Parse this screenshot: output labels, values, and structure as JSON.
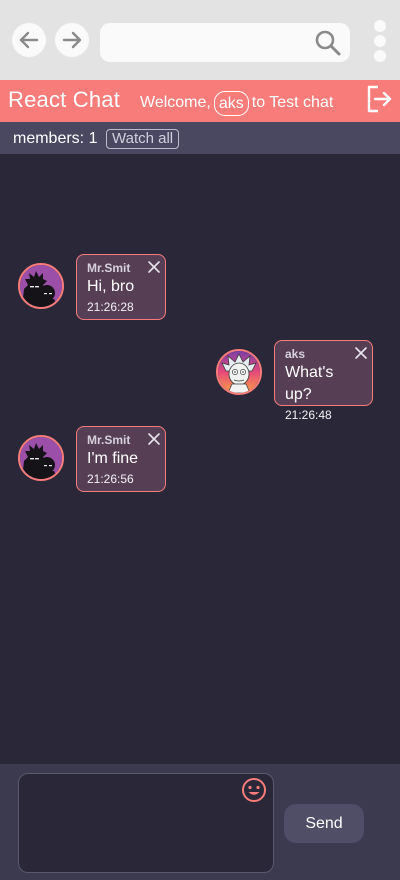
{
  "header": {
    "title": "React Chat",
    "welcome_prefix": "Welcome,",
    "username": "aks",
    "welcome_suffix": "to Test chat"
  },
  "members_bar": {
    "members_text": "members: 1",
    "watch_all_label": "Watch all"
  },
  "messages": [
    {
      "author": "Mr.Smit",
      "text": "Hi, bro",
      "time": "21:26:28",
      "side": "left",
      "avatar": "dark-figures-avatar"
    },
    {
      "author": "aks",
      "text": "What's up?",
      "time": "21:26:48",
      "side": "right",
      "avatar": "rick-avatar"
    },
    {
      "author": "Mr.Smit",
      "text": "I'm fine",
      "time": "21:26:56",
      "side": "left",
      "avatar": "dark-figures-avatar"
    }
  ],
  "composer": {
    "input_value": "",
    "send_label": "Send"
  },
  "colors": {
    "accent": "#f87c7a",
    "background": "#2a2838",
    "bubble": "#563f55",
    "members_bar": "#4a4860"
  },
  "icons": [
    "back-arrow-icon",
    "forward-arrow-icon",
    "search-icon",
    "menu-dots-icon",
    "logout-icon",
    "close-icon",
    "emoji-icon"
  ]
}
